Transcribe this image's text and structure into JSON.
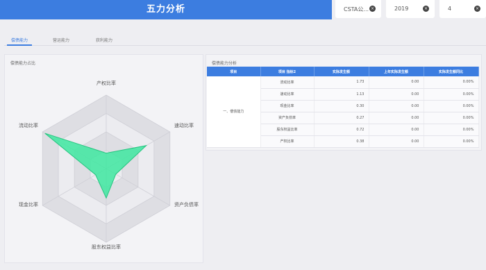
{
  "header": {
    "title": "五力分析"
  },
  "filters": {
    "company": "CSTA公...",
    "year": "2019",
    "period": "4",
    "clear_icon": "×"
  },
  "tabs": [
    {
      "label": "偿债能力",
      "active": true
    },
    {
      "label": "营运能力",
      "active": false
    },
    {
      "label": "获利能力",
      "active": false
    }
  ],
  "radar_panel": {
    "title": "偿债能力占比",
    "axes": [
      "产权比率",
      "速动比率",
      "资产负债率",
      "股东权益比率",
      "现金比率",
      "流动比率"
    ]
  },
  "chart_data": {
    "type": "radar",
    "axes": [
      "产权比率",
      "速动比率",
      "资产负债率",
      "股东权益比率",
      "现金比率",
      "流动比率"
    ],
    "values": [
      0.38,
      1.13,
      0.27,
      0.72,
      0.3,
      1.73
    ],
    "max": 1.8,
    "levels": 4,
    "fill_color": "#3ee8a0",
    "stroke_color": "#25c47f"
  },
  "table_panel": {
    "title": "偿债能力分析",
    "columns": [
      "项目",
      "项目 指标2",
      "实际发生额",
      "上年实际发生额",
      "实际发生额同比"
    ],
    "category": "一、偿债能力",
    "rows": [
      {
        "metric": "流动比率",
        "actual": "1.73",
        "prev": "0.00",
        "yoy": "0.00%"
      },
      {
        "metric": "速动比率",
        "actual": "1.13",
        "prev": "0.00",
        "yoy": "0.00%"
      },
      {
        "metric": "现金比率",
        "actual": "0.30",
        "prev": "0.00",
        "yoy": "0.00%"
      },
      {
        "metric": "资产负债率",
        "actual": "0.27",
        "prev": "0.00",
        "yoy": "0.00%"
      },
      {
        "metric": "股东权益比率",
        "actual": "0.72",
        "prev": "0.00",
        "yoy": "0.00%"
      },
      {
        "metric": "产权比率",
        "actual": "0.38",
        "prev": "0.00",
        "yoy": "0.00%"
      }
    ]
  },
  "colors": {
    "accent": "#3c7de0"
  }
}
